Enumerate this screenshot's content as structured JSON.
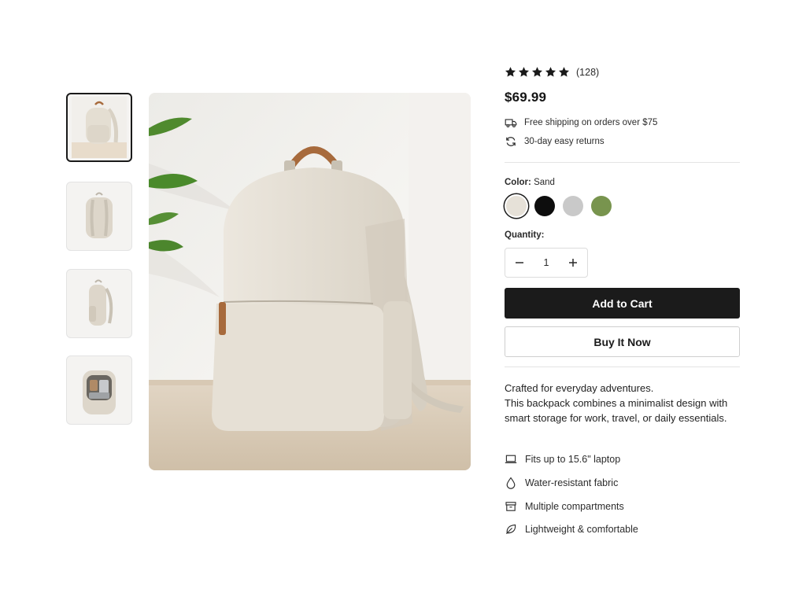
{
  "product": {
    "rating_stars": 5,
    "review_count": "(128)",
    "price": "$69.99",
    "shipping": "Free shipping on orders over $75",
    "returns": "30-day easy returns",
    "color_label": "Color:",
    "color_value": "Sand",
    "colors": [
      {
        "name": "Sand",
        "hex": "#e6e1d8"
      },
      {
        "name": "Black",
        "hex": "#0d0d0d"
      },
      {
        "name": "Gray",
        "hex": "#c9c9c9"
      },
      {
        "name": "Olive",
        "hex": "#78944e"
      }
    ],
    "quantity_label": "Quantity:",
    "quantity": "1",
    "add_to_cart": "Add to Cart",
    "buy_now": "Buy It Now",
    "description": "Crafted for everyday adventures.\nThis backpack combines a minimalist design with smart storage for work, travel, or daily essentials.",
    "description_line1": "Crafted for everyday adventures.",
    "description_line2": "This backpack combines a minimalist design with smart storage for work, travel, or daily essentials.",
    "features": [
      {
        "icon": "laptop-icon",
        "label": "Fits up to 15.6\" laptop"
      },
      {
        "icon": "water-drop-icon",
        "label": "Water-resistant fabric"
      },
      {
        "icon": "archive-box-icon",
        "label": "Multiple compartments"
      },
      {
        "icon": "leaf-icon",
        "label": "Lightweight & comfortable"
      }
    ]
  },
  "gallery": {
    "thumbnails": [
      {
        "icon": "backpack-front-angle-thumb"
      },
      {
        "icon": "backpack-back-thumb"
      },
      {
        "icon": "backpack-side-thumb"
      },
      {
        "icon": "backpack-open-thumb"
      }
    ]
  },
  "colors": {
    "primary_button": "#1b1b1b",
    "backpack": "#e4ded2",
    "leather_handle": "#a76a3c"
  }
}
